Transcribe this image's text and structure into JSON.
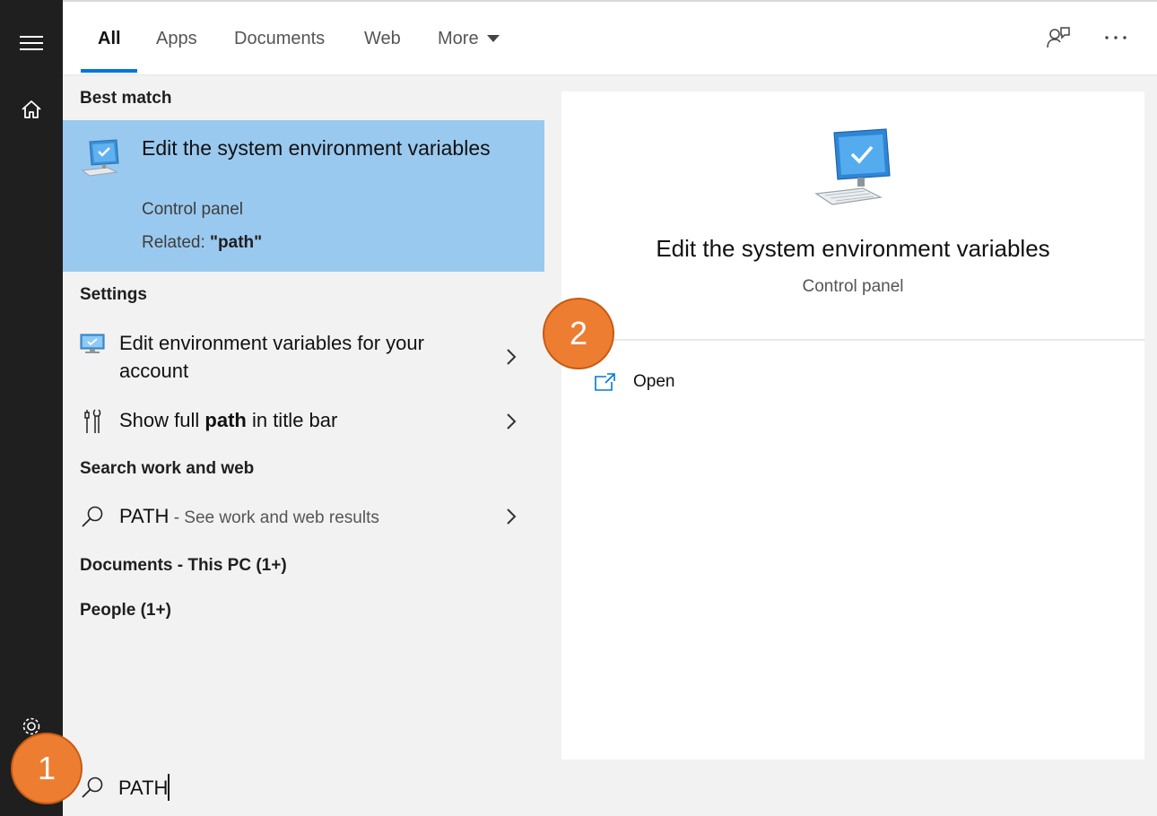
{
  "tabs": [
    {
      "label": "All",
      "active": true
    },
    {
      "label": "Apps"
    },
    {
      "label": "Documents"
    },
    {
      "label": "Web"
    },
    {
      "label": "More"
    }
  ],
  "sections": {
    "best_match": "Best match",
    "settings": "Settings",
    "search_work_web": "Search work and web",
    "documents": "Documents - This PC (1+)",
    "people": "People (1+)"
  },
  "best_match": {
    "title": "Edit the system environment variables",
    "category": "Control panel",
    "related_prefix": "Related: ",
    "related_term": "\"path\""
  },
  "settings_items": [
    {
      "label": "Edit environment variables for your account"
    },
    {
      "label_before": "Show full ",
      "label_bold": "path",
      "label_after": " in title bar"
    }
  ],
  "web_result": {
    "query": "PATH",
    "suffix": " - See work and web results"
  },
  "preview": {
    "title": "Edit the system environment variables",
    "subtitle": "Control panel",
    "open_label": "Open"
  },
  "search": {
    "value": "PATH"
  },
  "callouts": [
    "1",
    "2"
  ],
  "colors": {
    "accent": "#0078d7",
    "selection": "#9ac9ef",
    "callout": "#ed7d31",
    "rail": "#1f1f1f"
  },
  "icons": {
    "rail": [
      "hamburger-menu-icon",
      "home-icon",
      "gear-icon"
    ],
    "top": [
      "feedback-icon",
      "more-options-icon"
    ],
    "results": [
      "computer-monitor-icon",
      "monitor-settings-icon",
      "tools-icon",
      "search-icon",
      "chevron-right-icon"
    ],
    "preview": [
      "computer-monitor-icon",
      "open-external-icon"
    ]
  }
}
